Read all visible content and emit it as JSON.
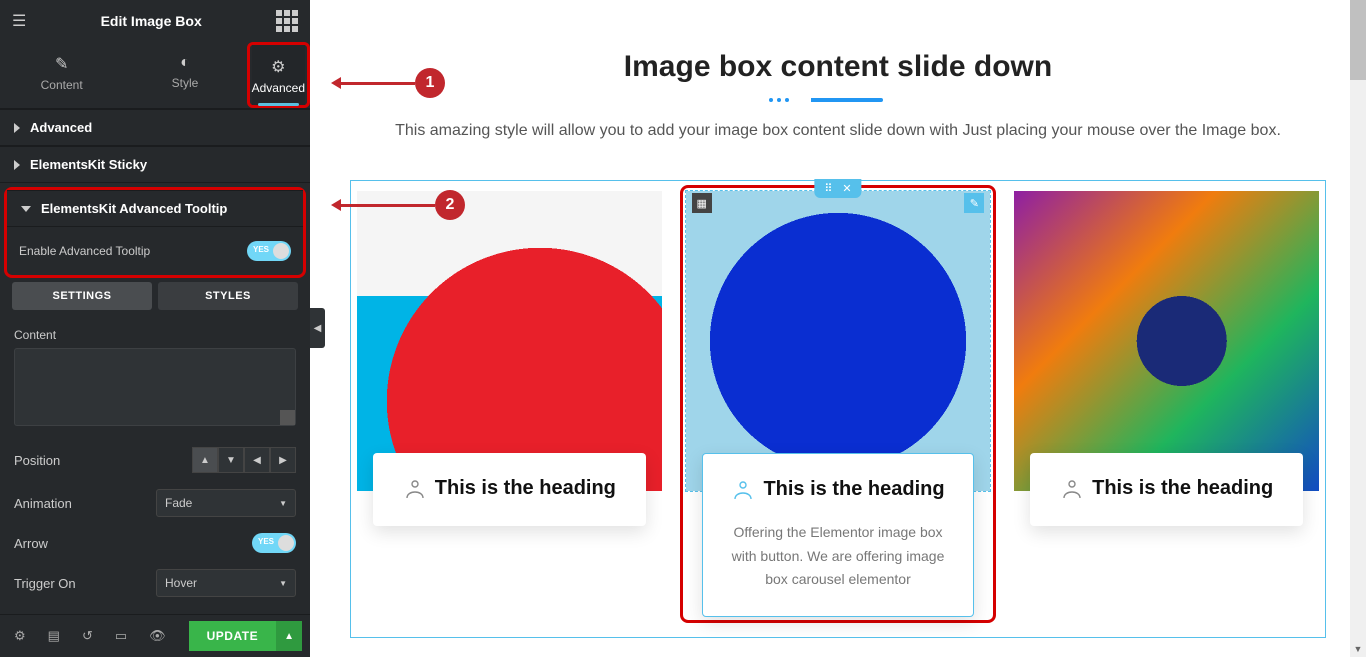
{
  "sidebar": {
    "title": "Edit Image Box",
    "tabs": {
      "content": "Content",
      "style": "Style",
      "advanced": "Advanced"
    },
    "sections": {
      "advanced": "Advanced",
      "sticky": "ElementsKit Sticky",
      "tooltip": "ElementsKit Advanced Tooltip"
    },
    "enable_tooltip_label": "Enable Advanced Tooltip",
    "toggle_yes": "YES",
    "settings_btn": "SETTINGS",
    "styles_btn": "STYLES",
    "content_label": "Content",
    "content_value": "",
    "position_label": "Position",
    "animation_label": "Animation",
    "animation_value": "Fade",
    "arrow_label": "Arrow",
    "trigger_label": "Trigger On",
    "trigger_value": "Hover"
  },
  "footer": {
    "update": "UPDATE"
  },
  "preview": {
    "title": "Image box content slide down",
    "subtitle": "This amazing style will allow you to add your image box content slide down with Just placing your mouse over the Image box."
  },
  "cards": [
    {
      "heading": "This is the heading"
    },
    {
      "heading": "This is the heading",
      "desc": "Offering the Elementor image box with button. We are offering image box carousel elementor"
    },
    {
      "heading": "This is the heading"
    }
  ],
  "callouts": {
    "one": "1",
    "two": "2"
  }
}
